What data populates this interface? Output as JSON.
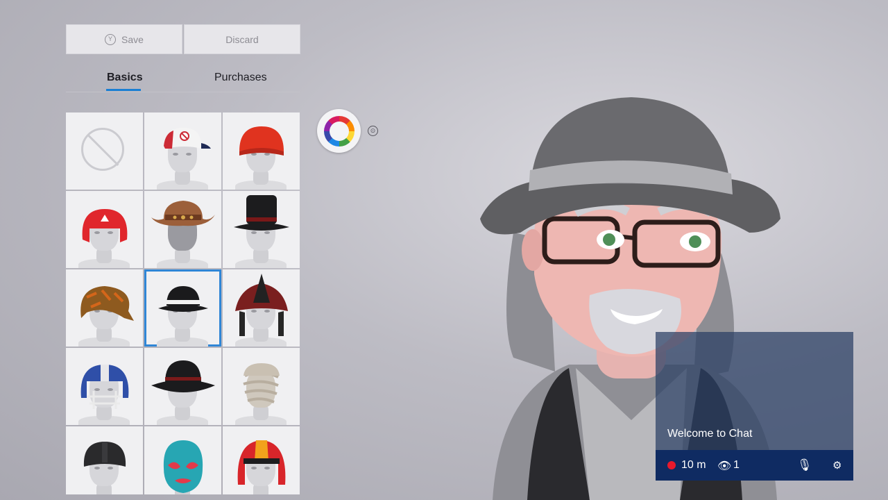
{
  "toolbar": {
    "save_glyph": "Y",
    "save_label": "Save",
    "discard_label": "Discard"
  },
  "tabs": [
    {
      "label": "Basics",
      "active": true
    },
    {
      "label": "Purchases",
      "active": false
    }
  ],
  "grid": {
    "selected_index": 7,
    "items": [
      {
        "name": "no-hat",
        "icon": "no-entry-icon"
      },
      {
        "name": "baseball-cap-white-red"
      },
      {
        "name": "beanie-red"
      },
      {
        "name": "boxing-headgear-red"
      },
      {
        "name": "cowboy-hat-brown"
      },
      {
        "name": "top-hat-black"
      },
      {
        "name": "bandana-camo-orange"
      },
      {
        "name": "fedora-black-white-band"
      },
      {
        "name": "firefighter-helmet"
      },
      {
        "name": "football-helmet-blue"
      },
      {
        "name": "wide-brim-hat-black"
      },
      {
        "name": "mummy-wrap"
      },
      {
        "name": "riding-helmet-black"
      },
      {
        "name": "luchador-mask-teal"
      },
      {
        "name": "motorcycle-helmet-red"
      }
    ]
  },
  "colors": {
    "accent": "#1a7fd4",
    "chat_bar": "#0f2b62",
    "record": "#e8192c"
  },
  "chat": {
    "title": "Welcome to Chat",
    "duration": "10 m",
    "viewers": "1",
    "icons": [
      "record-dot-icon",
      "eye-icon",
      "microphone-icon",
      "settings-icon"
    ]
  }
}
